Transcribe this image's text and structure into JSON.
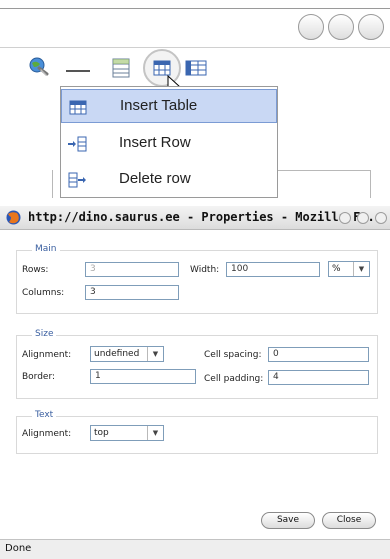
{
  "editor_toolbar": {
    "menu": {
      "items": [
        {
          "label": "Insert Table",
          "icon": "table-icon",
          "highlighted": true
        },
        {
          "label": "Insert Row",
          "icon": "insert-row-icon",
          "highlighted": false
        },
        {
          "label": "Delete row",
          "icon": "delete-row-icon",
          "highlighted": false
        }
      ]
    }
  },
  "window": {
    "title": "http://dino.saurus.ee - Properties - Mozilla F...",
    "status": "Done"
  },
  "main": {
    "legend": "Main",
    "rows_label": "Rows:",
    "rows_value": "3",
    "width_label": "Width:",
    "width_value": "100",
    "width_unit": "%",
    "columns_label": "Columns:",
    "columns_value": "3"
  },
  "size": {
    "legend": "Size",
    "alignment_label": "Alignment:",
    "alignment_value": "undefined",
    "cell_spacing_label": "Cell spacing:",
    "cell_spacing_value": "0",
    "border_label": "Border:",
    "border_value": "1",
    "cell_padding_label": "Cell padding:",
    "cell_padding_value": "4"
  },
  "text": {
    "legend": "Text",
    "alignment_label": "Alignment:",
    "alignment_value": "top"
  },
  "buttons": {
    "save": "Save",
    "close": "Close"
  },
  "colors": {
    "menu_highlight": "#c9d8f4",
    "legend_text": "#3a5fa0",
    "input_border": "#7f9db9"
  }
}
